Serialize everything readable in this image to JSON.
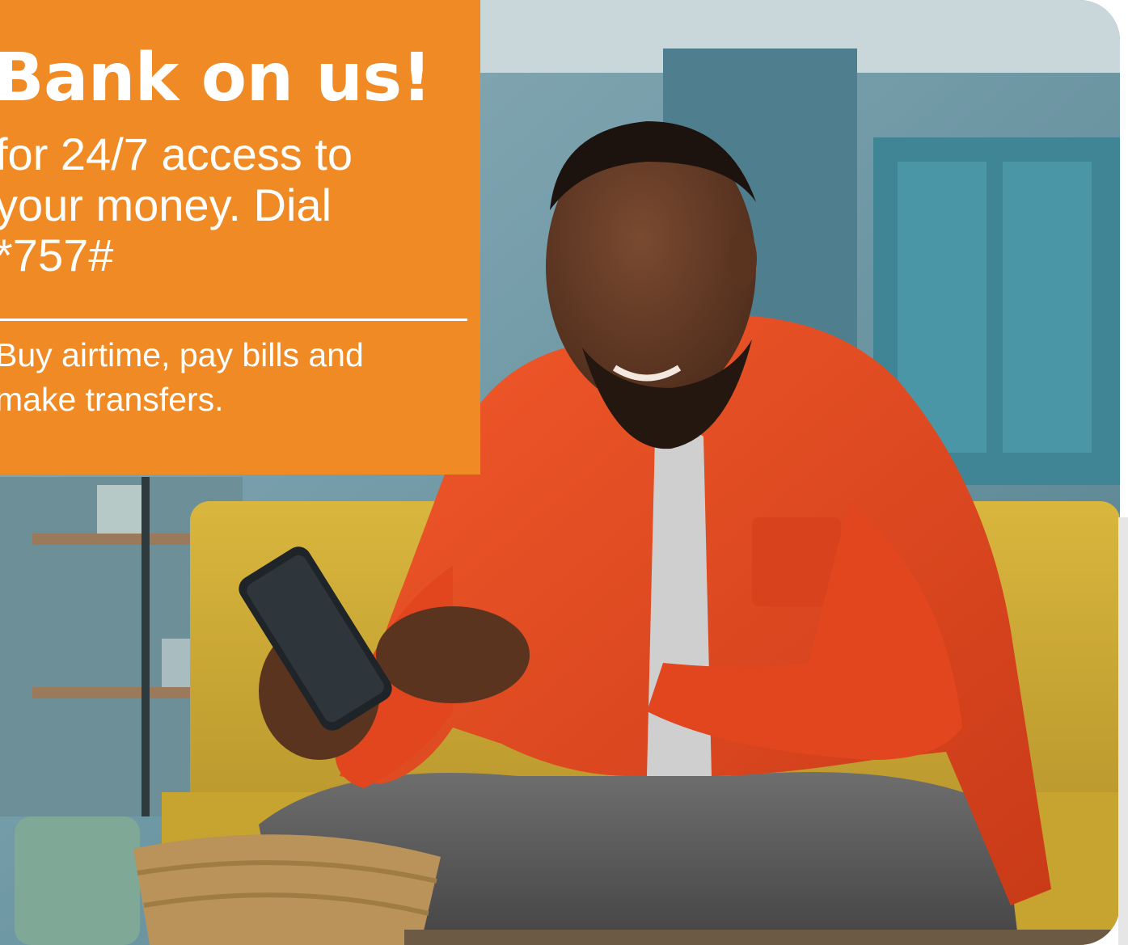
{
  "promo": {
    "headline": "Bank on us!",
    "subtitle": "for 24/7 access to\nyour money. Dial\n*757#",
    "detail": "Buy airtime, pay bills and\nmake transfers."
  },
  "colors": {
    "panel": "#f08a24",
    "jacket": "#e2461f",
    "sofa": "#d8b43a",
    "background": "#5f8a96"
  }
}
